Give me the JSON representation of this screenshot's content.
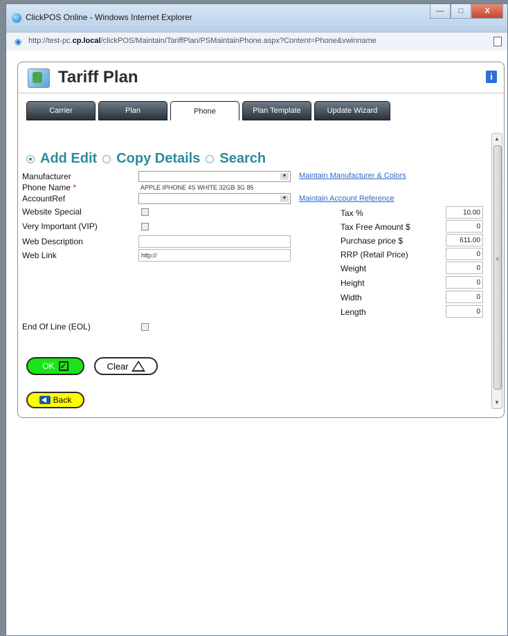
{
  "window": {
    "title": "ClickPOS Online - Windows Internet Explorer",
    "url_before": "http://test-pc.",
    "url_domain": "cp.local",
    "url_after": "/clickPOS/Maintain/TariffPlan/PSMaintainPhone.aspx?Content=Phone&vwinname",
    "buttons": {
      "min": "—",
      "max": "□",
      "close": "X"
    }
  },
  "header": {
    "title": "Tariff Plan",
    "info": "i"
  },
  "tabs": [
    {
      "label": "Carrier"
    },
    {
      "label": "Plan"
    },
    {
      "label": "Phone"
    },
    {
      "label": "Plan Template"
    },
    {
      "label": "Update Wizard"
    }
  ],
  "modes": [
    {
      "label": "Add Edit",
      "selected": true
    },
    {
      "label": "Copy Details",
      "selected": false
    },
    {
      "label": "Search",
      "selected": false
    }
  ],
  "form": {
    "labels": {
      "manufacturer": "Manufacturer",
      "phone_name": "Phone Name",
      "account_ref": "AccountRef",
      "website_special": "Website Special",
      "vip": "Very Important (VIP)",
      "web_description": "Web Description",
      "web_link": "Web Link",
      "eol": "End Of Line (EOL)"
    },
    "required_marker": "*",
    "values": {
      "manufacturer": "",
      "phone_name": "APPLE IPHONE 4S WHITE 32GB 3G 85",
      "account_ref": "",
      "web_description": "",
      "web_link": "http://"
    },
    "links": {
      "manufacturer": "Maintain Manufacturer & Colors",
      "account_ref": "Maintain Account Reference"
    }
  },
  "pricing": [
    {
      "label": "Tax %",
      "value": "10.00"
    },
    {
      "label": "Tax Free Amount $",
      "value": "0"
    },
    {
      "label": "Purchase price $",
      "value": "611.00"
    },
    {
      "label": "RRP (Retail Price)",
      "value": "0"
    },
    {
      "label": "Weight",
      "value": "0"
    },
    {
      "label": "Height",
      "value": "0"
    },
    {
      "label": "Width",
      "value": "0"
    },
    {
      "label": "Length",
      "value": "0"
    }
  ],
  "actions": {
    "ok": "OK",
    "ok_check": "✓",
    "clear": "Clear",
    "back": "Back"
  },
  "scrollbar": {
    "up": "▲",
    "down": "▼",
    "grip": "≡"
  },
  "dropdown_arrow": "▼",
  "colors": {
    "ok": "#19e419",
    "back": "#ffff00",
    "links": "#2d66c7",
    "radio_text": "#2c8a9f",
    "tab_dark": "#28323c"
  }
}
